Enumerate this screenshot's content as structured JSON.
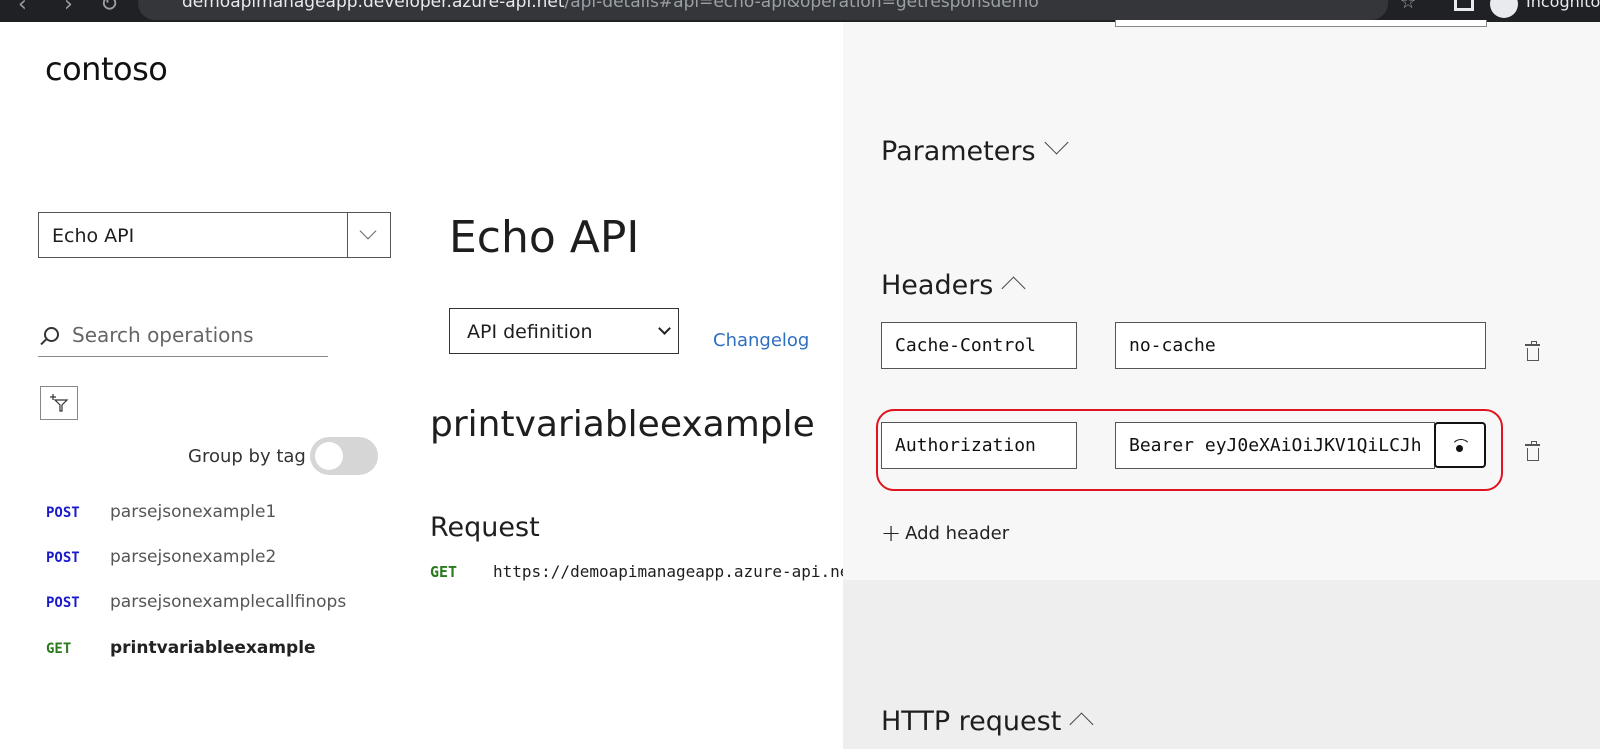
{
  "browser": {
    "url_host": "demoapimanageapp.developer.azure-api.net",
    "url_path": "/api-details#api=echo-api&operation=getresponsdemo",
    "mode_label": "Incognito"
  },
  "brand": {
    "logo": "contoso"
  },
  "sidebar": {
    "api_selected": "Echo API",
    "search_placeholder": "Search operations",
    "group_by_tag_label": "Group by tag",
    "group_by_tag_on": false,
    "operations": [
      {
        "method": "POST",
        "name": "parsejsonexample1"
      },
      {
        "method": "POST",
        "name": "parsejsonexample2"
      },
      {
        "method": "POST",
        "name": "parsejsonexamplecallfinops"
      },
      {
        "method": "GET",
        "name": "printvariableexample",
        "active": true
      }
    ]
  },
  "main": {
    "api_title": "Echo API",
    "definition_selected": "API definition",
    "changelog_label": "Changelog",
    "operation_title": "printvariableexample",
    "request_heading": "Request",
    "request_method": "GET",
    "request_url": "https://demoapimanageapp.azure-api.net/echo/printvariableexample"
  },
  "console": {
    "parameters_heading": "Parameters",
    "headers_heading": "Headers",
    "headers": [
      {
        "name": "Cache-Control",
        "value": "no-cache"
      },
      {
        "name": "Authorization",
        "value": "Bearer eyJ0eXAiOiJKV1QiLCJh"
      }
    ],
    "add_header_label": "Add header",
    "http_request_heading": "HTTP request",
    "highlight_color": "#e0141e"
  }
}
